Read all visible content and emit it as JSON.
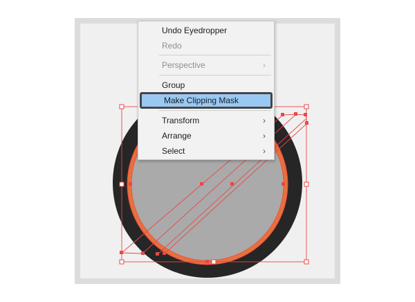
{
  "context_menu": {
    "items": [
      {
        "label": "Undo Eyedropper",
        "enabled": true,
        "submenu": false
      },
      {
        "label": "Redo",
        "enabled": false,
        "submenu": false
      },
      {
        "label": "Perspective",
        "enabled": false,
        "submenu": true
      },
      {
        "label": "Group",
        "enabled": true,
        "submenu": false
      },
      {
        "label": "Make Clipping Mask",
        "enabled": true,
        "submenu": false,
        "highlighted": true
      },
      {
        "label": "Transform",
        "enabled": true,
        "submenu": true
      },
      {
        "label": "Arrange",
        "enabled": true,
        "submenu": true
      },
      {
        "label": "Select",
        "enabled": true,
        "submenu": true
      }
    ],
    "submenu_icon": "chevron-right-icon"
  },
  "artwork": {
    "outer_ring_color": "#262626",
    "orange_ring_color": "#e8703a",
    "inner_fill_color": "#aaaaaa",
    "selection_color": "#e84848"
  },
  "colors": {
    "canvas_bg": "#f0f0f0",
    "frame_bg": "#dcdcdc",
    "menu_highlight": "#99c9f3"
  }
}
